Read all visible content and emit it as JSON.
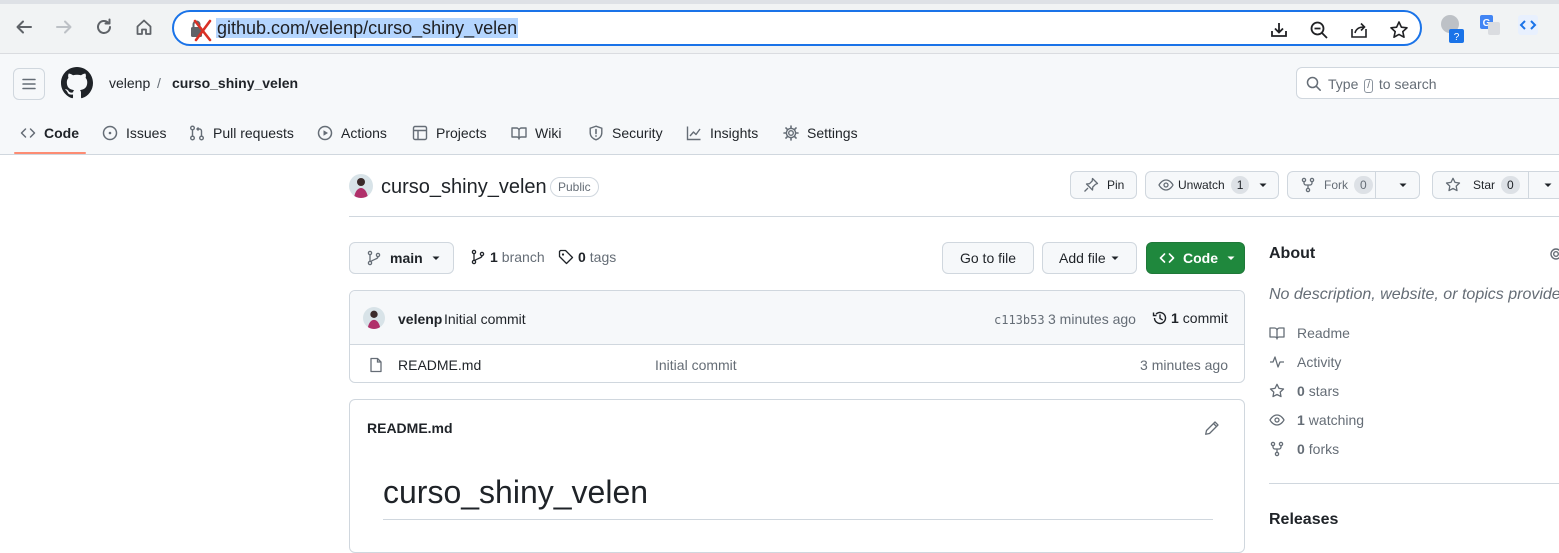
{
  "browser": {
    "url": "github.com/velenp/curso_shiny_velen",
    "omnibox_icons": [
      "download-icon",
      "zoom-out-icon",
      "share-icon",
      "bookmark-star-icon"
    ],
    "extension_badge": "?"
  },
  "header": {
    "owner": "velenp",
    "separator": "/",
    "repo": "curso_shiny_velen",
    "search": {
      "prefix": "Type",
      "kbd": "/",
      "suffix": "to search"
    }
  },
  "tabs": [
    {
      "label": "Code",
      "icon": "code-icon",
      "active": true
    },
    {
      "label": "Issues",
      "icon": "issue-icon"
    },
    {
      "label": "Pull requests",
      "icon": "pull-request-icon"
    },
    {
      "label": "Actions",
      "icon": "play-icon"
    },
    {
      "label": "Projects",
      "icon": "table-icon"
    },
    {
      "label": "Wiki",
      "icon": "book-icon"
    },
    {
      "label": "Security",
      "icon": "shield-icon"
    },
    {
      "label": "Insights",
      "icon": "graph-icon"
    },
    {
      "label": "Settings",
      "icon": "gear-icon"
    }
  ],
  "repo": {
    "title": "curso_shiny_velen",
    "visibility": "Public",
    "pin": "Pin",
    "unwatch": "Unwatch",
    "watch_count": "1",
    "fork": "Fork",
    "fork_count": "0",
    "star": "Star",
    "star_count": "0"
  },
  "branch_bar": {
    "branch": "main",
    "branch_count": "1",
    "branch_label": "branch",
    "tag_count": "0",
    "tag_label": "tags",
    "go_to_file": "Go to file",
    "add_file": "Add file",
    "code": "Code"
  },
  "commit": {
    "author": "velenp",
    "message": "Initial commit",
    "sha": "c113b53",
    "time": "3 minutes ago",
    "count": "1",
    "count_label": "commit"
  },
  "files": [
    {
      "name": "README.md",
      "message": "Initial commit",
      "time": "3 minutes ago",
      "icon": "file-icon"
    }
  ],
  "readme": {
    "filename": "README.md",
    "heading": "curso_shiny_velen"
  },
  "about": {
    "title": "About",
    "description": "No description, website, or topics provided.",
    "items": [
      {
        "icon": "book-icon",
        "bold": "",
        "label": "Readme"
      },
      {
        "icon": "pulse-icon",
        "bold": "",
        "label": "Activity"
      },
      {
        "icon": "star-icon",
        "bold": "0",
        "label": "stars"
      },
      {
        "icon": "eye-icon",
        "bold": "1",
        "label": "watching"
      },
      {
        "icon": "fork-icon",
        "bold": "0",
        "label": "forks"
      }
    ],
    "releases": "Releases"
  },
  "colors": {
    "accent_green": "#1f883d",
    "active_tab_underline": "#fd8c73",
    "omnibox_focus": "#1a73e8"
  }
}
